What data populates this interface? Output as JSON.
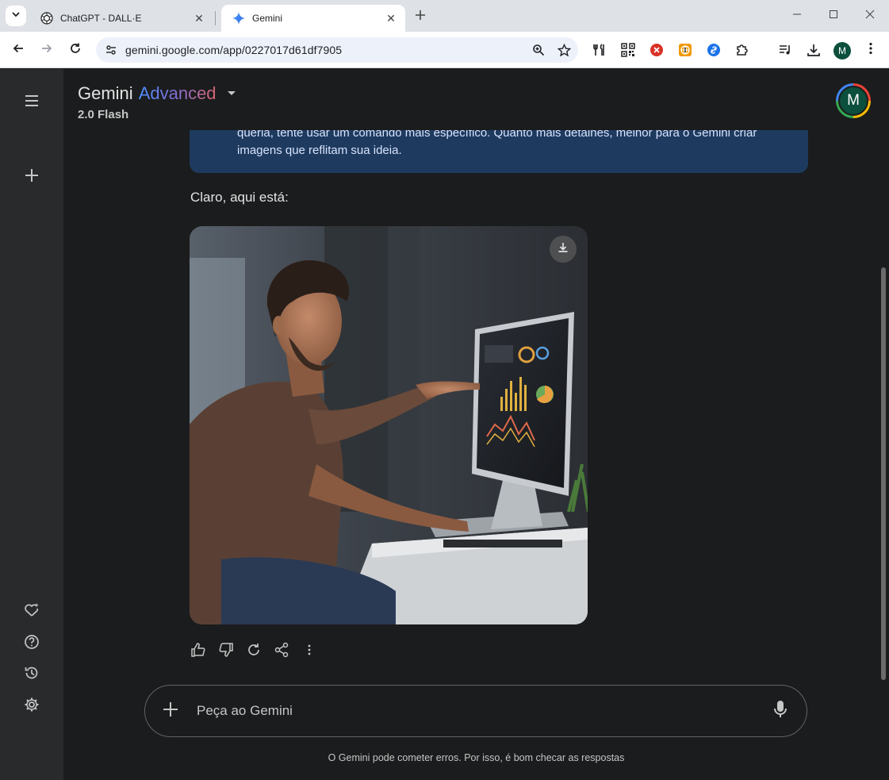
{
  "browser": {
    "tabs": [
      {
        "title": "ChatGPT - DALL·E",
        "icon": "openai-icon",
        "active": false
      },
      {
        "title": "Gemini",
        "icon": "gemini-spark-icon",
        "active": true
      }
    ],
    "url": "gemini.google.com/app/0227017d61df7905",
    "profile_initial": "M"
  },
  "app": {
    "brand": "Gemini",
    "tier": "Advanced",
    "model": "2.0 Flash",
    "avatar_initial": "M"
  },
  "conversation": {
    "info_lines": [
      "queria, tente usar um comando mais específico. Quanto mais detalhes, melhor para o Gemini criar",
      "imagens que reflitam sua ideia."
    ],
    "reply": "Claro, aqui está:"
  },
  "composer": {
    "placeholder": "Peça ao Gemini"
  },
  "disclaimer": "O Gemini pode cometer erros. Por isso, é bom checar as respostas",
  "colors": {
    "app_bg": "#1b1c1d",
    "sidebar_bg": "#282a2c",
    "info_bg": "#1e3a5f",
    "accent_blue": "#4b90ff",
    "accent_red": "#d96570"
  }
}
